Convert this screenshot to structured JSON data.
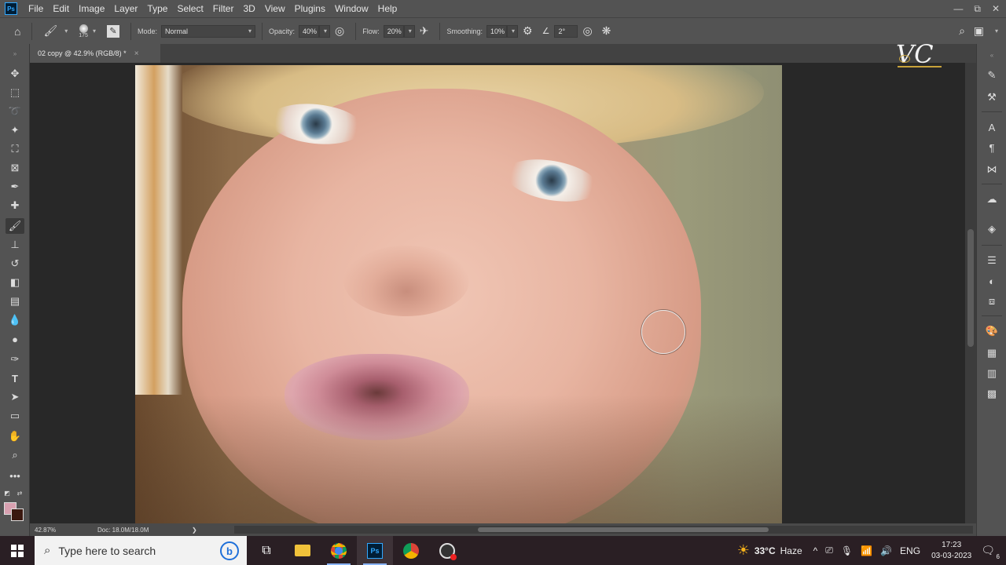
{
  "app": {
    "logo": "Ps"
  },
  "menu": [
    "File",
    "Edit",
    "Image",
    "Layer",
    "Type",
    "Select",
    "Filter",
    "3D",
    "View",
    "Plugins",
    "Window",
    "Help"
  ],
  "window_controls": {
    "minimize": "—",
    "restore": "⧉",
    "close": "✕"
  },
  "options_bar": {
    "brush_size": "175",
    "mode_label": "Mode:",
    "mode_value": "Normal",
    "opacity_label": "Opacity:",
    "opacity_value": "40%",
    "flow_label": "Flow:",
    "flow_value": "20%",
    "smoothing_label": "Smoothing:",
    "smoothing_value": "10%",
    "angle_value": "2°"
  },
  "document_tab": {
    "title": "02 copy @ 42.9% (RGB/8) *",
    "close": "×"
  },
  "status_bar": {
    "zoom": "42.87%",
    "doc_info": "Doc: 18.0M/18.0M",
    "arrow": "❯"
  },
  "watermark": {
    "text": "VC"
  },
  "colors": {
    "foreground": "#d8a0b0",
    "background": "#3a1810",
    "accent": "#31a8ff"
  },
  "taskbar": {
    "search_placeholder": "Type here to search",
    "bing": "b",
    "weather_temp": "33°C",
    "weather_desc": "Haze",
    "language": "ENG",
    "time": "17:23",
    "date": "03-03-2023",
    "notification_count": "6"
  }
}
